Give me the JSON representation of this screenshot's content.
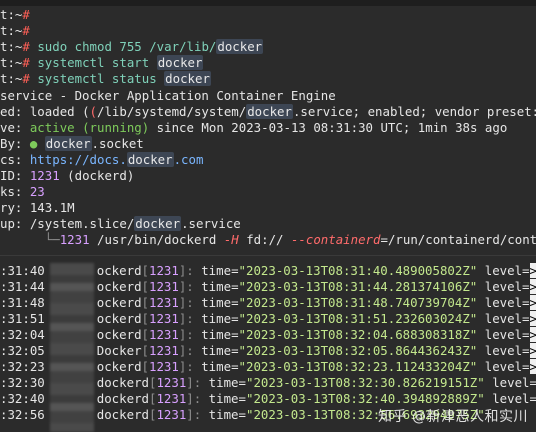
{
  "terminal": {
    "prompt_lines": [
      {
        "prefix": "t:~",
        "sym": "#",
        "cmd": "",
        "extra": ""
      },
      {
        "prefix": "t:~",
        "sym": "#",
        "cmd": "",
        "extra": ""
      },
      {
        "prefix": "t:~",
        "sym": "#",
        "cmd": "sudo chmod 755 /var/lib/",
        "extra": "docker"
      },
      {
        "prefix": "t:~",
        "sym": "#",
        "cmd": "systemctl start ",
        "extra": "docker"
      },
      {
        "prefix": "t:~",
        "sym": "#",
        "cmd": "systemctl status ",
        "extra": "docker"
      }
    ],
    "status": {
      "title": "service - Docker Application Container Engine",
      "loaded_label": "ed:",
      "loaded_value_1": " loaded (",
      "loaded_path_pre": "/lib/systemd/system/",
      "loaded_path_hl": "docker",
      "loaded_path_post": ".service; enabled; vendor preset:",
      "active_label": "ve:",
      "active_state": " active (running)",
      "active_rest": " since Mon 2023-03-13 08:31:30 UTC; 1min 38s ago",
      "by_label": "By:",
      "by_dot": " ●",
      "by_hl": "docker",
      "by_rest": ".socket",
      "docs_label": "cs:",
      "docs_pre": " https://docs.",
      "docs_hl": "docker",
      "docs_post": ".com",
      "pid_label": "ID:",
      "pid_value": " 1231",
      "pid_rest": " (dockerd)",
      "tasks_label": "ks:",
      "tasks_value": " 23",
      "mem_label": "ry:",
      "mem_value": " 143.1M",
      "cgroup_label": "up:",
      "cgroup_pre": " /system.slice/",
      "cgroup_hl": "docker",
      "cgroup_post": ".service",
      "tree_pre": "      └─",
      "tree_pid": "1231",
      "tree_mid": " /usr/bin/dockerd ",
      "tree_flag": "-H",
      "tree_fd": " fd:// ",
      "tree_dash": "--containerd",
      "tree_end": "=/run/containerd/conta"
    },
    "log_lines": [
      {
        "t": ":31:40",
        "proc": "ockerd",
        "pid": "1231",
        "time": "2023-03-13T08:31:40.489005802Z",
        "lvl": "level="
      },
      {
        "t": ":31:44",
        "proc": "ockerd",
        "pid": "1231",
        "time": "2023-03-13T08:31:44.281374106Z",
        "lvl": "level="
      },
      {
        "t": ":31:48",
        "proc": "ockerd",
        "pid": "1231",
        "time": "2023-03-13T08:31:48.740739704Z",
        "lvl": "level="
      },
      {
        "t": ":31:51",
        "proc": "ockerd",
        "pid": "1231",
        "time": "2023-03-13T08:31:51.232603024Z",
        "lvl": "level="
      },
      {
        "t": ":32:04",
        "proc": "ockerd",
        "pid": "1231",
        "time": "2023-03-13T08:32:04.688308318Z",
        "lvl": "level="
      },
      {
        "t": ":32:05",
        "proc": "Docker",
        "pid": "1231",
        "time": "2023-03-13T08:32:05.864436243Z",
        "lvl": "level="
      },
      {
        "t": ":32:23",
        "proc": "ockerd",
        "pid": "1231",
        "time": "2023-03-13T08:32:23.112433204Z",
        "lvl": "level="
      },
      {
        "t": ":32:30",
        "proc": "dockerd",
        "pid": "1231",
        "time": "2023-03-13T08:32:30.826219151Z",
        "lvl": "level="
      },
      {
        "t": ":32:40",
        "proc": "dockerd",
        "pid": "1231",
        "time": "2023-03-13T08:32:40.394892889Z",
        "lvl": "level="
      },
      {
        "t": ":32:56",
        "proc": "dockerd",
        "pid": "1231",
        "time": "2023-03-13T08:32:56.693294975Z",
        "lvl": ""
      }
    ],
    "watermark": "知乎 @新津恶人和实川"
  }
}
